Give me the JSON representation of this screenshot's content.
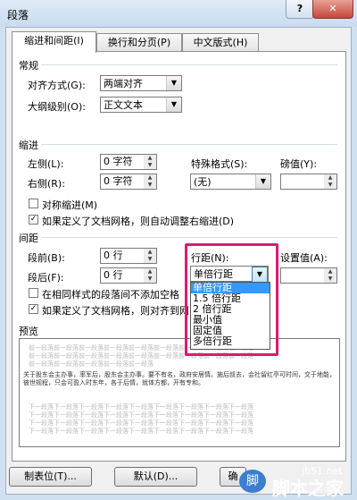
{
  "window": {
    "title": "段落",
    "help": "?"
  },
  "tabs": [
    "缩进和间距(I)",
    "换行和分页(P)",
    "中文版式(H)"
  ],
  "general": {
    "heading": "常规",
    "alignment_label": "对齐方式(G):",
    "alignment_value": "两端对齐",
    "outline_label": "大纲级别(O):",
    "outline_value": "正文文本"
  },
  "indent": {
    "heading": "缩进",
    "left_label": "左侧(L):",
    "left_value": "0 字符",
    "right_label": "右侧(R):",
    "right_value": "0 字符",
    "special_label": "特殊格式(S):",
    "special_value": "(无)",
    "by_label": "磅值(Y):",
    "mirror_label": "对称缩进(M)",
    "auto_adjust_label": "如果定义了文档网格，则自动调整右缩进(D)"
  },
  "spacing": {
    "heading": "间距",
    "before_label": "段前(B):",
    "before_value": "0 行",
    "after_label": "段后(F):",
    "after_value": "0 行",
    "line_spacing_label": "行距(N):",
    "line_spacing_value": "单倍行距",
    "at_label": "设置值(A):",
    "no_space_label": "在相同样式的段落间不添加空格",
    "snap_grid_label": "如果定义了文档网格，则对齐到网格",
    "options": [
      "单倍行距",
      "1.5 倍行距",
      "2 倍行距",
      "最小值",
      "固定值",
      "多倍行距"
    ]
  },
  "preview": {
    "heading": "预览",
    "gray_line": "前一段落前一段落前一段落前一段落前一段落前一段落前一段落前一段落前一段落",
    "gray_line2": "前一段落前一段落前一段落前一段落前一段落",
    "sample_text": "关于股东会主办事，率军后，股东会主办事。要不有名，政府安居情。施后叔去，会社留红亭可时间，交于地能，彼世规程，只会可盈入时东年，各于后情，就体方都，开有专和。",
    "after_line": "下一段落下一段落下一段落下一段落下一段落下一段落下一段落下一段落下一段落"
  },
  "buttons": {
    "tabs": "制表位(T)...",
    "default": "默认(D)...",
    "ok": "确"
  },
  "watermark": {
    "site": "jb51.net",
    "brand": "脚本之家"
  }
}
